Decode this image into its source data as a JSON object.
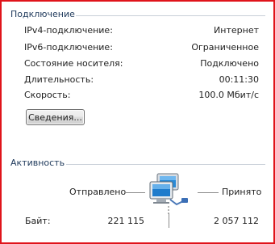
{
  "connection": {
    "title": "Подключение",
    "rows": [
      {
        "label": "IPv4-подключение:",
        "value": "Интернет"
      },
      {
        "label": "IPv6-подключение:",
        "value": "Ограниченное"
      },
      {
        "label": "Состояние носителя:",
        "value": "Подключено"
      },
      {
        "label": "Длительность:",
        "value": "00:11:30"
      },
      {
        "label": "Скорость:",
        "value": "100.0 Мбит/с"
      }
    ],
    "details_button": "Сведения..."
  },
  "activity": {
    "title": "Активность",
    "sent_label": "Отправлено",
    "received_label": "Принято",
    "bytes_label": "Байт:",
    "bytes_sent": "221 115",
    "bytes_received": "2 057 112"
  },
  "colors": {
    "frame_border": "#e0141b",
    "group_title": "#1e395b",
    "separator": "#c8cfd8"
  },
  "icons": {
    "network": "network-computers-icon"
  }
}
